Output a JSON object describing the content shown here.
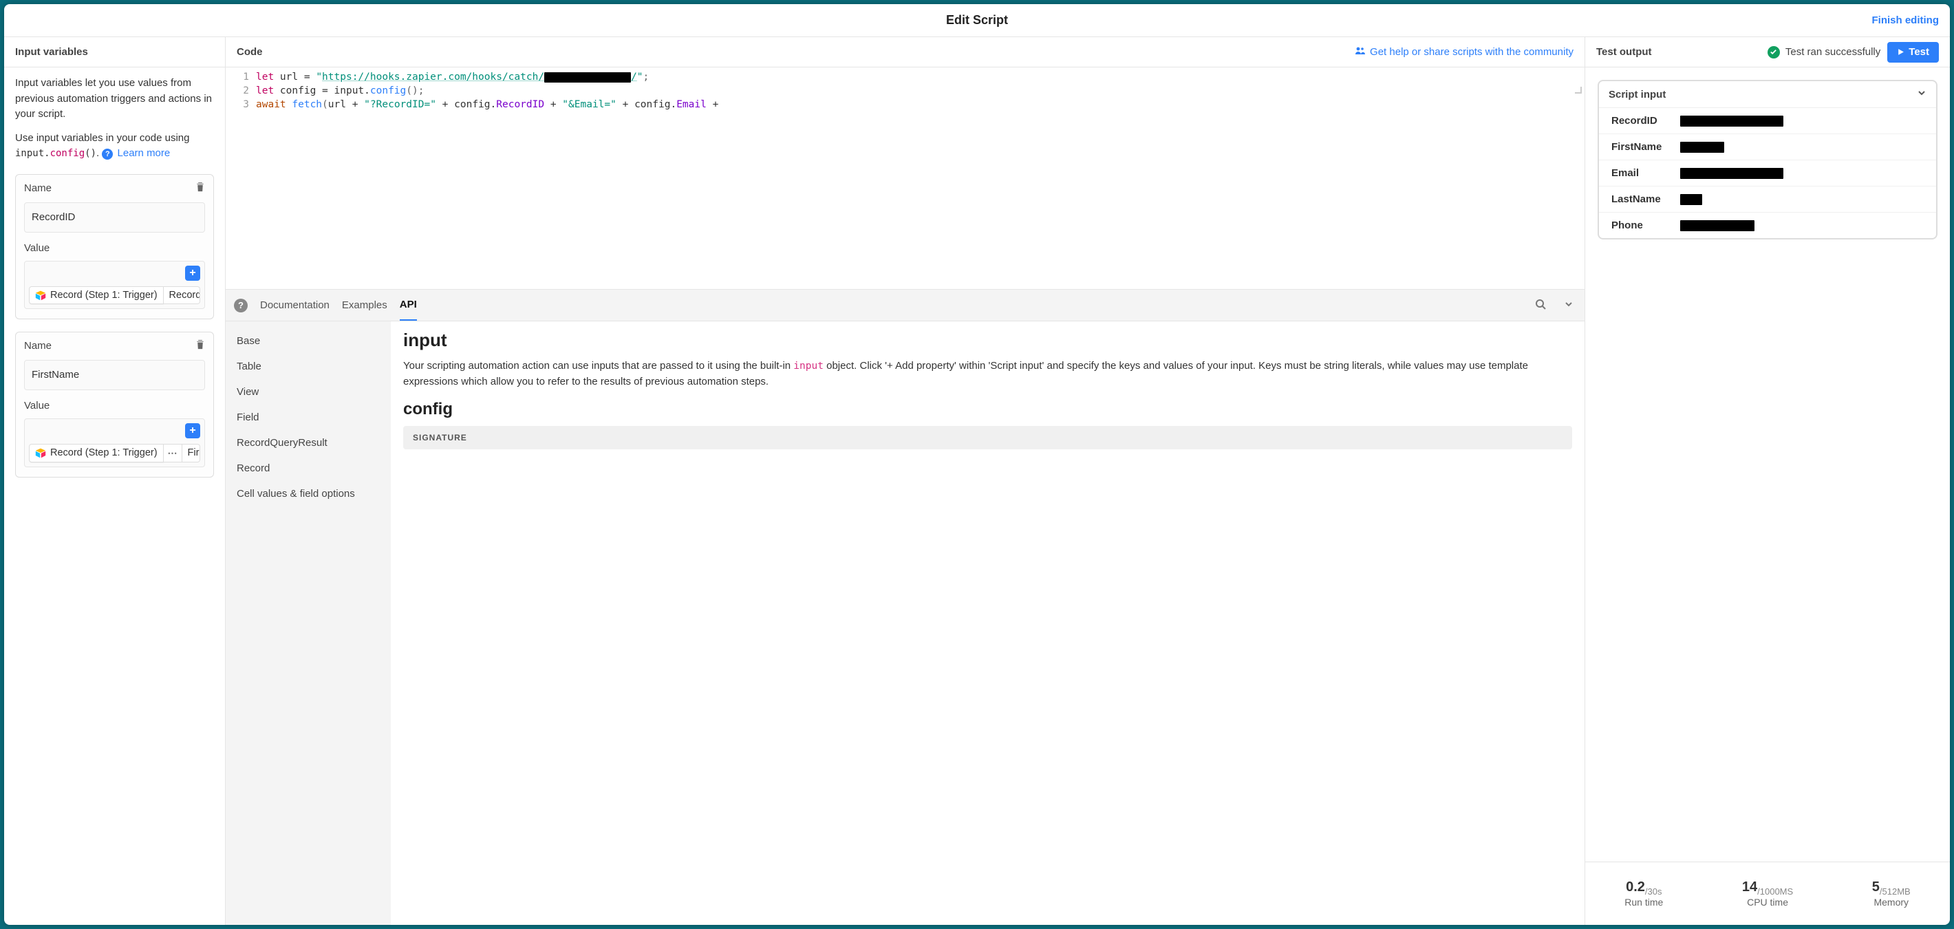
{
  "titlebar": {
    "title": "Edit Script",
    "finish": "Finish editing"
  },
  "left": {
    "header": "Input variables",
    "help1": "Input variables let you use values from previous automation triggers and actions in your script.",
    "help2_prefix": "Use input variables in your code using ",
    "help2_code_let": "input.",
    "help2_code_fn": "config",
    "help2_code_tail": "()",
    "learn_more": "Learn more",
    "vars": [
      {
        "name_label": "Name",
        "value_label": "Value",
        "name": "RecordID",
        "pill": "Record (Step 1: Trigger)",
        "has_extra": false,
        "tail": "Record"
      },
      {
        "name_label": "Name",
        "value_label": "Value",
        "name": "FirstName",
        "pill": "Record (Step 1: Trigger)",
        "has_extra": true,
        "tail": "Fir"
      }
    ]
  },
  "middle": {
    "header": "Code",
    "help_link": "Get help or share scripts with the community",
    "code": {
      "gutter": [
        "1",
        "2",
        "3"
      ],
      "l1_let": "let",
      "l1_url_eq": " url = ",
      "l1_q1": "\"",
      "l1_url": "https://hooks.zapier.com/hooks/catch/",
      "l1_redact_w": 126,
      "l1_slash": "/",
      "l1_q2": "\"",
      "l1_semi": ";",
      "l2_let": "let",
      "l2_rest": " config = input.",
      "l2_fn": "config",
      "l2_tail": "();",
      "l3_await": "await",
      "l3_fn": " fetch",
      "l3_open": "(",
      "l3_a": "url + ",
      "l3_s1": "\"?RecordID=\"",
      "l3_b": " + config.",
      "l3_p1": "RecordID",
      "l3_c": " + ",
      "l3_s2": "\"&Email=\"",
      "l3_d": " + config.",
      "l3_p2": "Email",
      "l3_e": " + "
    },
    "docs": {
      "tabs": [
        "Documentation",
        "Examples",
        "API"
      ],
      "active_tab": 2,
      "nav": [
        "Base",
        "Table",
        "View",
        "Field",
        "RecordQueryResult",
        "Record",
        "Cell values & field options"
      ],
      "h2": "input",
      "para_a": "Your scripting automation action can use inputs that are passed to it using the built-in ",
      "para_code": "input",
      "para_b": " object. Click '+ Add property' within 'Script input' and specify the keys and values of your input. Keys must be string literals, while values may use template expressions which allow you to refer to the results of previous automation steps.",
      "h3": "config",
      "sig": "SIGNATURE"
    }
  },
  "right": {
    "header": "Test output",
    "status": "Test ran successfully",
    "test_label": "Test",
    "script_input_title": "Script input",
    "rows": [
      {
        "key": "RecordID",
        "w": 150
      },
      {
        "key": "FirstName",
        "w": 64
      },
      {
        "key": "Email",
        "w": 150
      },
      {
        "key": "LastName",
        "w": 32
      },
      {
        "key": "Phone",
        "w": 108
      }
    ],
    "metrics": {
      "run": {
        "big": "0.2",
        "sub": "/30s",
        "label": "Run time"
      },
      "cpu": {
        "big": "14",
        "sub": "/1000MS",
        "label": "CPU time"
      },
      "mem": {
        "big": "5",
        "sub": "/512MB",
        "label": "Memory"
      }
    }
  }
}
